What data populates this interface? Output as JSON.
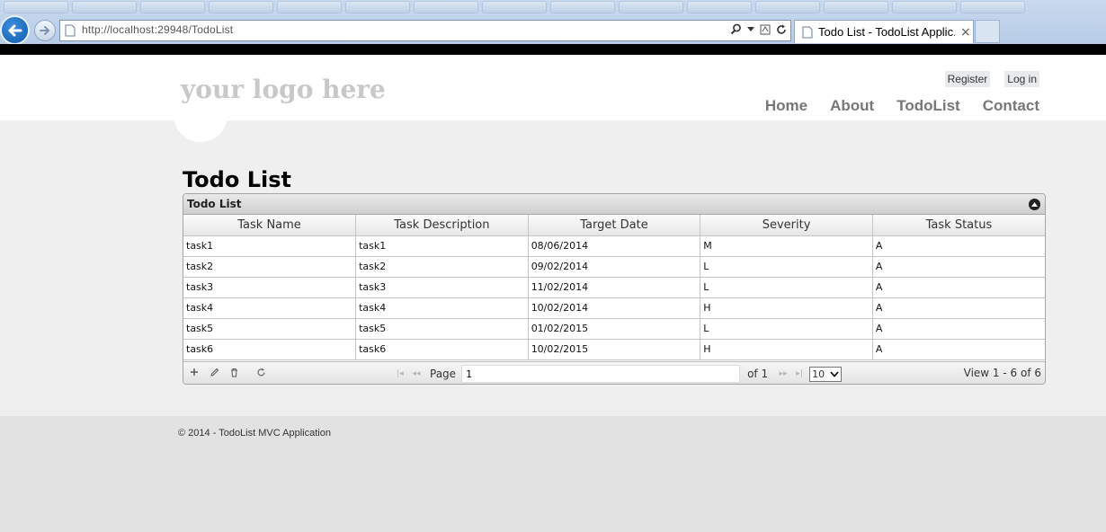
{
  "browser": {
    "url_host": "http://localhost",
    "url_rest": ":29948/TodoList",
    "active_tab_title": "Todo List - TodoList Applic...",
    "tab_close": "×"
  },
  "site": {
    "logo": "your logo here",
    "auth": [
      "Register",
      "Log in"
    ],
    "nav": [
      "Home",
      "About",
      "TodoList",
      "Contact"
    ]
  },
  "page": {
    "title": "Todo List"
  },
  "grid": {
    "caption": "Todo List",
    "columns": [
      "Task Name",
      "Task Description",
      "Target Date",
      "Severity",
      "Task Status"
    ],
    "rows": [
      [
        "task1",
        "task1",
        "08/06/2014",
        "M",
        "A"
      ],
      [
        "task2",
        "task2",
        "09/02/2014",
        "L",
        "A"
      ],
      [
        "task3",
        "task3",
        "11/02/2014",
        "L",
        "A"
      ],
      [
        "task4",
        "task4",
        "10/02/2014",
        "H",
        "A"
      ],
      [
        "task5",
        "task5",
        "01/02/2015",
        "L",
        "A"
      ],
      [
        "task6",
        "task6",
        "10/02/2015",
        "H",
        "A"
      ]
    ]
  },
  "pager": {
    "page_label": "Page",
    "page_value": "1",
    "of_label": "of 1",
    "rows_per_page": "10",
    "view_info": "View 1 - 6 of 6"
  },
  "footer": {
    "text": "© 2014 - TodoList MVC Application"
  },
  "colors": {
    "accent": "#0f5aa8",
    "header_bg": "#ffffff",
    "body_bg": "#efefef",
    "nav_text": "#777777"
  },
  "icons": [
    "back-icon",
    "forward-icon",
    "search-icon",
    "refresh-icon",
    "page-icon",
    "add-icon",
    "edit-icon",
    "delete-icon",
    "reload-icon",
    "collapse-icon"
  ]
}
